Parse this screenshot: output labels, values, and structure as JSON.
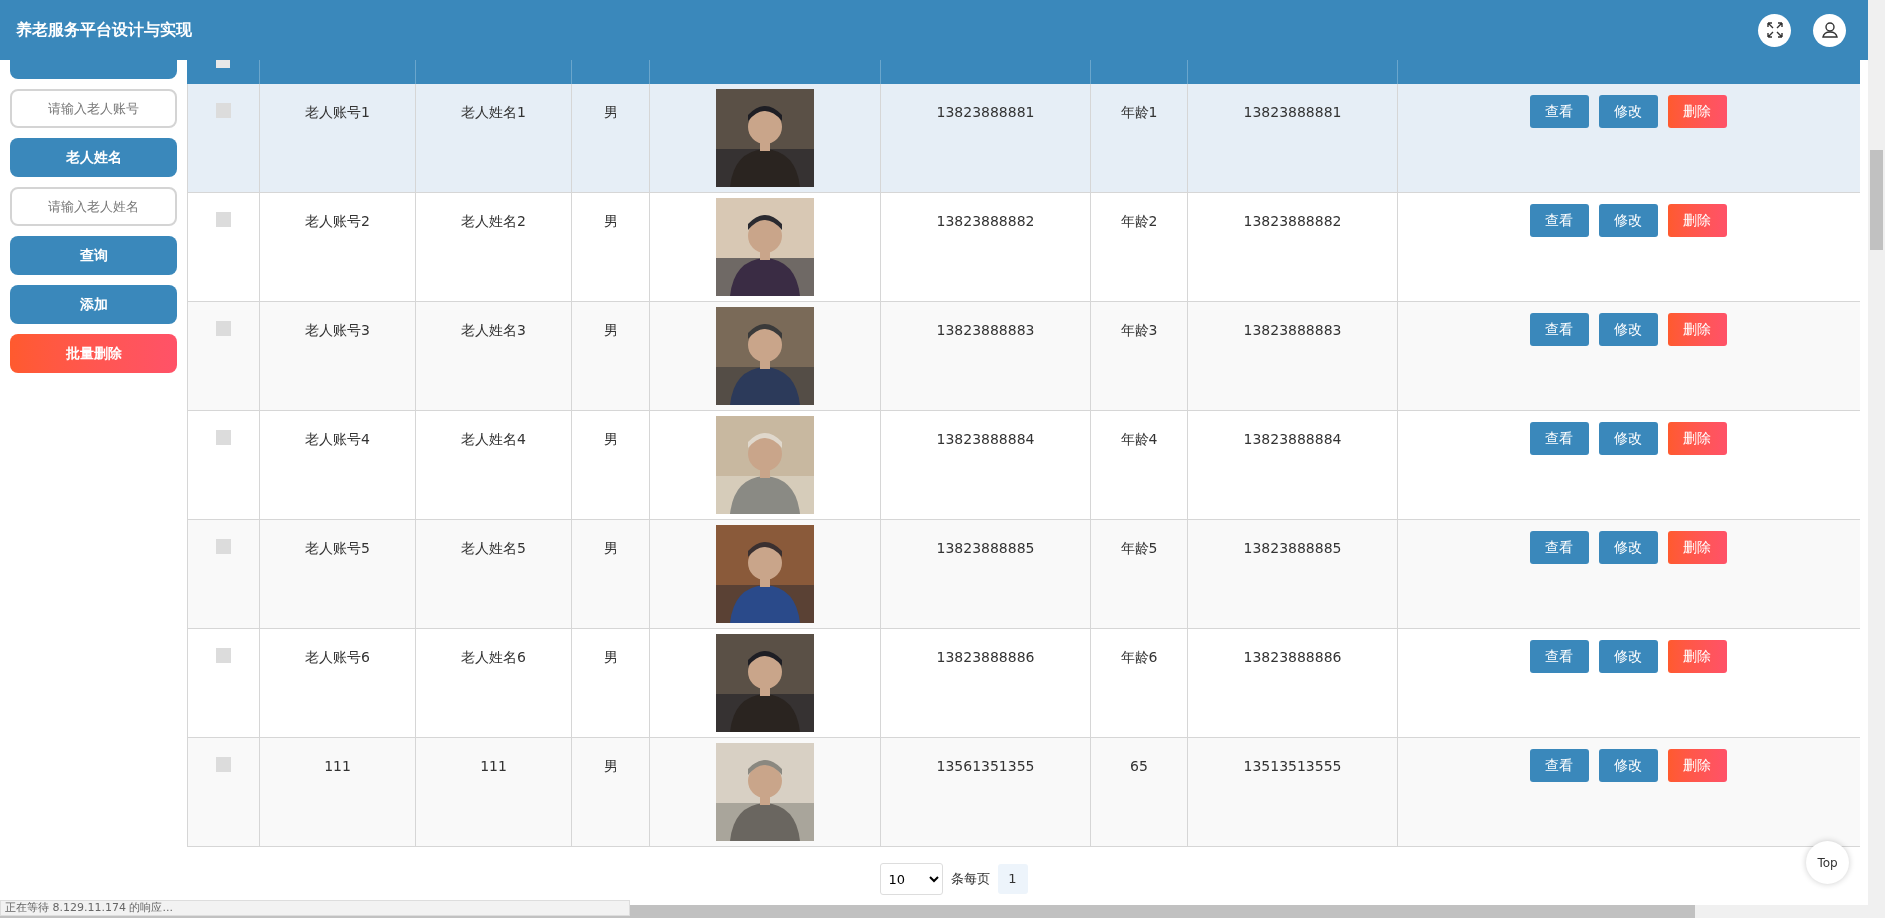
{
  "header": {
    "title": "养老服务平台设计与实现"
  },
  "sidebar": [
    {
      "kind": "label"
    },
    {
      "kind": "input",
      "placeholder": "请输入老人账号"
    },
    {
      "kind": "label",
      "text": "老人姓名"
    },
    {
      "kind": "input",
      "placeholder": "请输入老人姓名"
    },
    {
      "kind": "button",
      "text": "查询"
    },
    {
      "kind": "button",
      "text": "添加"
    },
    {
      "kind": "danger",
      "text": "批量删除"
    }
  ],
  "table": {
    "header_checked": false,
    "rows": [
      {
        "highlighted": true,
        "checked": false,
        "account": "老人账号1",
        "name": "老人姓名1",
        "gender": "男",
        "phone": "13823888881",
        "age": "年龄1",
        "family_phone": "13823888881",
        "actions": [
          {
            "kind": "primary",
            "label": "查看"
          },
          {
            "kind": "primary",
            "label": "修改"
          },
          {
            "kind": "danger",
            "label": "删除"
          }
        ]
      },
      {
        "highlighted": false,
        "checked": false,
        "account": "老人账号2",
        "name": "老人姓名2",
        "gender": "男",
        "phone": "13823888882",
        "age": "年龄2",
        "family_phone": "13823888882",
        "actions": [
          {
            "kind": "primary",
            "label": "查看"
          },
          {
            "kind": "primary",
            "label": "修改"
          },
          {
            "kind": "danger",
            "label": "删除"
          }
        ]
      },
      {
        "highlighted": false,
        "checked": false,
        "account": "老人账号3",
        "name": "老人姓名3",
        "gender": "男",
        "phone": "13823888883",
        "age": "年龄3",
        "family_phone": "13823888883",
        "actions": [
          {
            "kind": "primary",
            "label": "查看"
          },
          {
            "kind": "primary",
            "label": "修改"
          },
          {
            "kind": "danger",
            "label": "删除"
          }
        ]
      },
      {
        "highlighted": false,
        "checked": false,
        "account": "老人账号4",
        "name": "老人姓名4",
        "gender": "男",
        "phone": "13823888884",
        "age": "年龄4",
        "family_phone": "13823888884",
        "actions": [
          {
            "kind": "primary",
            "label": "查看"
          },
          {
            "kind": "primary",
            "label": "修改"
          },
          {
            "kind": "danger",
            "label": "删除"
          }
        ]
      },
      {
        "highlighted": false,
        "checked": false,
        "account": "老人账号5",
        "name": "老人姓名5",
        "gender": "男",
        "phone": "13823888885",
        "age": "年龄5",
        "family_phone": "13823888885",
        "actions": [
          {
            "kind": "primary",
            "label": "查看"
          },
          {
            "kind": "primary",
            "label": "修改"
          },
          {
            "kind": "danger",
            "label": "删除"
          }
        ]
      },
      {
        "highlighted": false,
        "checked": false,
        "account": "老人账号6",
        "name": "老人姓名6",
        "gender": "男",
        "phone": "13823888886",
        "age": "年龄6",
        "family_phone": "13823888886",
        "actions": [
          {
            "kind": "primary",
            "label": "查看"
          },
          {
            "kind": "primary",
            "label": "修改"
          },
          {
            "kind": "danger",
            "label": "删除"
          }
        ]
      },
      {
        "highlighted": false,
        "checked": false,
        "account": "111",
        "name": "111",
        "gender": "男",
        "phone": "13561351355",
        "age": "65",
        "family_phone": "13513513555",
        "actions": [
          {
            "kind": "primary",
            "label": "查看"
          },
          {
            "kind": "primary",
            "label": "修改"
          },
          {
            "kind": "danger",
            "label": "删除"
          }
        ]
      }
    ]
  },
  "pagination": {
    "page_size": "10",
    "per_page_label": "条每页",
    "pages": [
      {
        "label": "1",
        "selected": true
      }
    ]
  },
  "top_button": "Top",
  "status_text": "正在等待 8.129.11.174 的响应..."
}
